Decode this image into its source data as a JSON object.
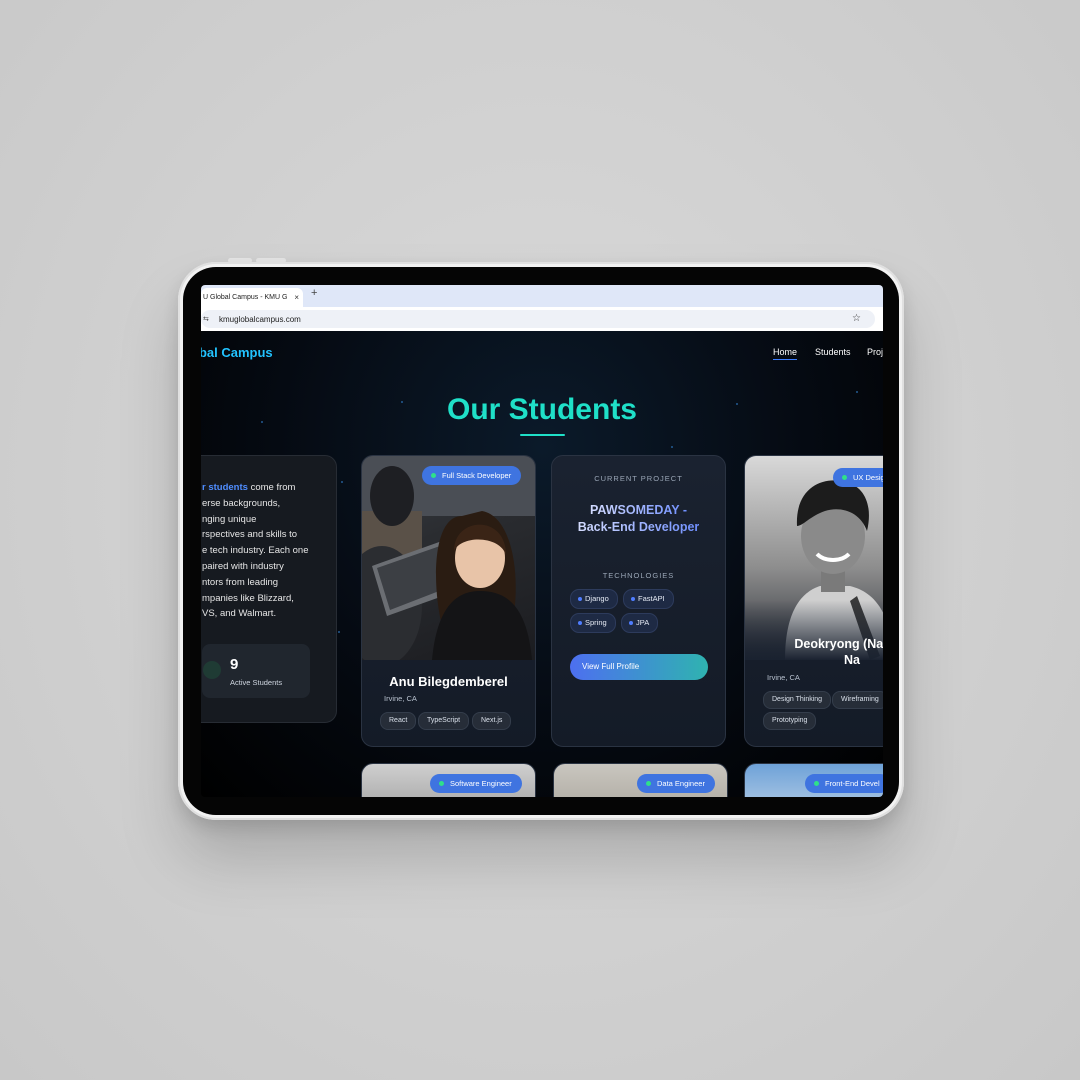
{
  "browser": {
    "tab_title": "U Global Campus - KMU G",
    "tab_close": "×",
    "new_tab": "+",
    "url": "kmuglobalcampus.com"
  },
  "header": {
    "brand": "obal Campus",
    "nav": [
      "Home",
      "Students",
      "Proj"
    ]
  },
  "main": {
    "title": "Our Students",
    "intro": {
      "highlight": "r students",
      "lines": [
        " come from",
        "erse backgrounds,",
        "nging unique",
        "rspectives and skills to",
        "e tech industry. Each one",
        "paired with industry",
        "ntors from leading",
        "mpanies like Blizzard,",
        "VS, and Walmart."
      ],
      "stat_value": "9",
      "stat_label": "Active Students"
    },
    "students": [
      {
        "role": "Full Stack Developer",
        "name": "Anu Bilegdemberel",
        "location": "Irvine, CA",
        "tags": [
          "React",
          "TypeScript",
          "Next.js"
        ]
      },
      {
        "role": "UX Desig",
        "name_line1": "Deokryong (Nathan",
        "name_line2": "Na",
        "location": "Irvine, CA",
        "tags": [
          "Design Thinking",
          "Wireframing",
          "Prototyping"
        ]
      }
    ],
    "project": {
      "label": "CURRENT PROJECT",
      "title_line1": "PAWSOMEDAY -",
      "title_line2": "Back-End Developer",
      "tech_label": "TECHNOLOGIES",
      "techs": [
        "Django",
        "FastAPI",
        "Spring",
        "JPA"
      ],
      "cta": "View Full Profile"
    },
    "next_row_roles": [
      "Software Engineer",
      "Data Engineer",
      "Front-End Devel"
    ]
  },
  "colors": {
    "accent_teal": "#1fe0c8",
    "brand_blue": "#22c3ff",
    "badge_blue": "#3f74e0",
    "dot_green": "#2fe08a"
  }
}
